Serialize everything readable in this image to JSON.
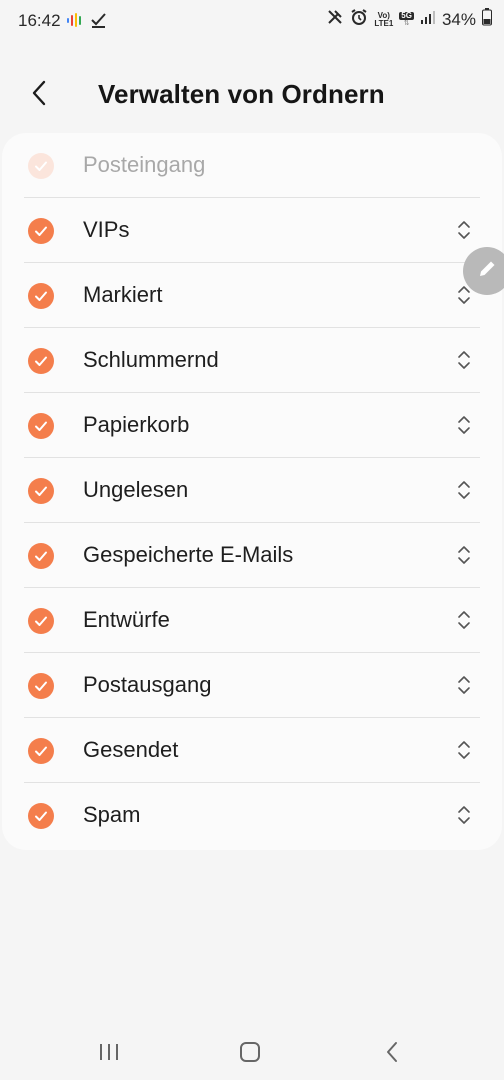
{
  "status_bar": {
    "time": "16:42",
    "battery": "34%",
    "network_badge_top": "Vo)",
    "network_badge_bottom": "LTE1",
    "five_g_badge": "5G"
  },
  "header": {
    "title": "Verwalten von Ordnern"
  },
  "folders": [
    {
      "label": "Posteingang",
      "checked": true,
      "disabled": true
    },
    {
      "label": "VIPs",
      "checked": true
    },
    {
      "label": "Markiert",
      "checked": true
    },
    {
      "label": "Schlummernd",
      "checked": true
    },
    {
      "label": "Papierkorb",
      "checked": true
    },
    {
      "label": "Ungelesen",
      "checked": true
    },
    {
      "label": "Gespeicherte E-Mails",
      "checked": true
    },
    {
      "label": "Entwürfe",
      "checked": true
    },
    {
      "label": "Postausgang",
      "checked": true
    },
    {
      "label": "Gesendet",
      "checked": true
    },
    {
      "label": "Spam",
      "checked": true
    }
  ],
  "colors": {
    "accent": "#f47e4c",
    "accent_disabled": "#fbe5dc",
    "background": "#f5f5f5",
    "card": "#fbfbfb"
  },
  "icons": {
    "back": "chevron-left-icon",
    "check": "checkmark-icon",
    "reorder": "reorder-icon",
    "edit": "pencil-icon",
    "nav_recents": "recents-icon",
    "nav_home": "home-icon",
    "nav_back": "nav-back-icon"
  }
}
